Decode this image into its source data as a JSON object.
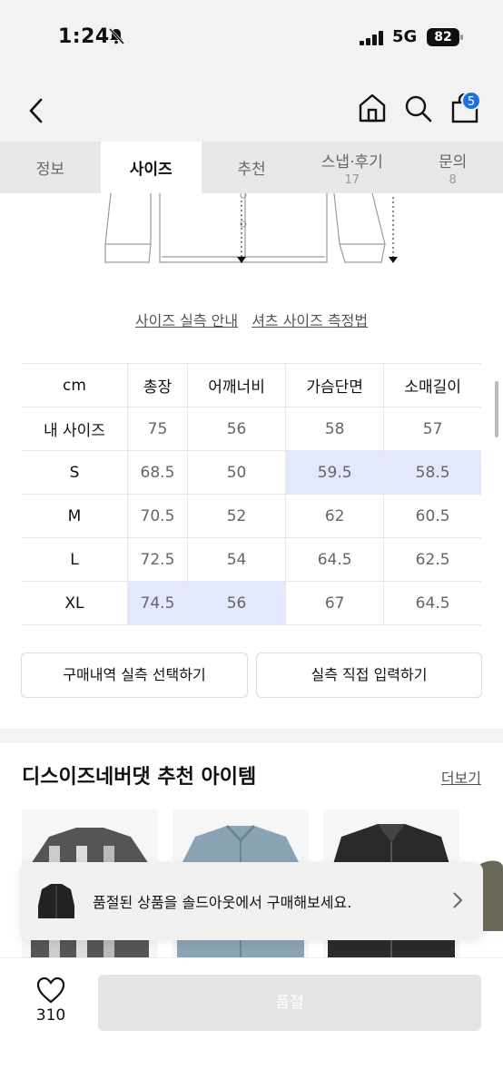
{
  "status": {
    "time": "1:24",
    "network": "5G",
    "battery": "82"
  },
  "nav": {
    "cart_count": "5"
  },
  "tabs": [
    {
      "label": "정보",
      "count": ""
    },
    {
      "label": "사이즈",
      "count": ""
    },
    {
      "label": "추천",
      "count": ""
    },
    {
      "label": "스냅·후기",
      "count": "17"
    },
    {
      "label": "문의",
      "count": "8"
    }
  ],
  "guide": {
    "link1": "사이즈 실측 안내",
    "link2": "셔츠 사이즈 측정법"
  },
  "size_table": {
    "headers": [
      "cm",
      "총장",
      "어깨너비",
      "가슴단면",
      "소매길이"
    ],
    "rows": [
      {
        "label": "내 사이즈",
        "values": [
          "75",
          "56",
          "58",
          "57"
        ]
      },
      {
        "label": "S",
        "values": [
          "68.5",
          "50",
          "59.5",
          "58.5"
        ]
      },
      {
        "label": "M",
        "values": [
          "70.5",
          "52",
          "62",
          "60.5"
        ]
      },
      {
        "label": "L",
        "values": [
          "72.5",
          "54",
          "64.5",
          "62.5"
        ]
      },
      {
        "label": "XL",
        "values": [
          "74.5",
          "56",
          "67",
          "64.5"
        ]
      }
    ],
    "highlight_color": "#e4e8fc"
  },
  "buttons": {
    "purchase_history": "구매내역 실측 선택하기",
    "direct_input": "실측 직접 입력하기"
  },
  "recommend": {
    "title": "디스이즈네버댓 추천 아이템",
    "more": "더보기"
  },
  "toast": {
    "text": "품절된 상품을 솔드아웃에서 구매해보세요."
  },
  "bottom": {
    "likes": "310",
    "soldout_label": "품절"
  },
  "colors": {
    "accent": "#1f6fe5",
    "tab_bg": "#e8e8e8"
  }
}
